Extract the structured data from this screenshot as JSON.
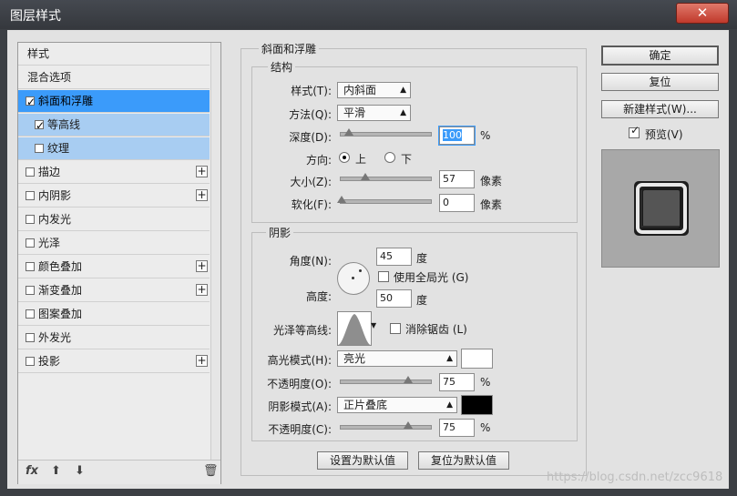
{
  "window": {
    "title": "图层样式",
    "close_glyph": "✕"
  },
  "sidebar": {
    "items": [
      {
        "label": "样式"
      },
      {
        "label": "混合选项"
      },
      {
        "label": "斜面和浮雕"
      },
      {
        "label": "等高线"
      },
      {
        "label": "纹理"
      },
      {
        "label": "描边"
      },
      {
        "label": "内阴影"
      },
      {
        "label": "内发光"
      },
      {
        "label": "光泽"
      },
      {
        "label": "颜色叠加"
      },
      {
        "label": "渐变叠加"
      },
      {
        "label": "图案叠加"
      },
      {
        "label": "外发光"
      },
      {
        "label": "投影"
      }
    ],
    "fx_label": "fx",
    "icons": [
      "fx-icon",
      "move-up-icon",
      "move-down-icon",
      "trash-icon"
    ]
  },
  "bevel": {
    "group_title": "斜面和浮雕",
    "structure_title": "结构",
    "style_label": "样式(T):",
    "style_value": "内斜面",
    "technique_label": "方法(Q):",
    "technique_value": "平滑",
    "depth_label": "深度(D):",
    "depth_value": "100",
    "depth_unit": "%",
    "direction_label": "方向:",
    "dir_up": "上",
    "dir_down": "下",
    "size_label": "大小(Z):",
    "size_value": "57",
    "size_unit": "像素",
    "soften_label": "软化(F):",
    "soften_value": "0",
    "soften_unit": "像素"
  },
  "shading": {
    "title": "阴影",
    "angle_label": "角度(N):",
    "angle_value": "45",
    "angle_unit": "度",
    "global_light_label": "使用全局光 (G)",
    "altitude_label": "高度:",
    "altitude_value": "50",
    "altitude_unit": "度",
    "gloss_label": "光泽等高线:",
    "antialias_label": "消除锯齿 (L)",
    "highlight_mode_label": "高光模式(H):",
    "highlight_mode_value": "亮光",
    "highlight_color": "#ffffff",
    "highlight_opacity_label": "不透明度(O):",
    "highlight_opacity_value": "75",
    "shadow_mode_label": "阴影模式(A):",
    "shadow_mode_value": "正片叠底",
    "shadow_color": "#000000",
    "shadow_opacity_label": "不透明度(C):",
    "shadow_opacity_value": "75",
    "percent": "%"
  },
  "footer": {
    "set_default": "设置为默认值",
    "reset_default": "复位为默认值"
  },
  "actions": {
    "ok": "确定",
    "reset": "复位",
    "new_style": "新建样式(W)...",
    "preview": "预览(V)"
  },
  "watermark": "https://blog.csdn.net/zcc9618"
}
